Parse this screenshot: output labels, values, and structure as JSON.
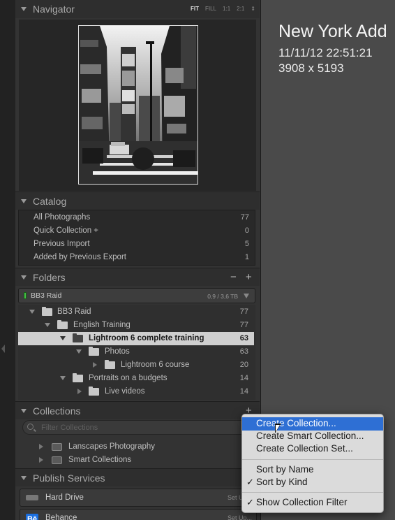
{
  "navigator": {
    "title": "Navigator",
    "zoom_options": [
      "FIT",
      "FILL",
      "1:1",
      "2:1"
    ],
    "active_zoom": "FIT"
  },
  "catalog": {
    "title": "Catalog",
    "items": [
      {
        "label": "All Photographs",
        "count": "77"
      },
      {
        "label": "Quick Collection  +",
        "count": "0"
      },
      {
        "label": "Previous Import",
        "count": "5"
      },
      {
        "label": "Added by Previous Export",
        "count": "1"
      }
    ]
  },
  "folders": {
    "title": "Folders",
    "minus": "−",
    "plus": "+",
    "volume": {
      "name": "BB3 Raid",
      "capacity": "0,9 / 3,6 TB",
      "status_color": "#43c043"
    },
    "items": [
      {
        "label": "BB3 Raid",
        "count": "77"
      },
      {
        "label": "English Training",
        "count": "77"
      },
      {
        "label": "Lightroom 6 complete training",
        "count": "63"
      },
      {
        "label": "Photos",
        "count": "63"
      },
      {
        "label": "Lightroom 6 course",
        "count": "20"
      },
      {
        "label": "Portraits on a budgets",
        "count": "14"
      },
      {
        "label": "Live videos",
        "count": "14"
      }
    ]
  },
  "collections": {
    "title": "Collections",
    "plus": "+",
    "filter_placeholder": "Filter Collections",
    "items": [
      {
        "label": "Lanscapes Photography"
      },
      {
        "label": "Smart Collections"
      }
    ]
  },
  "publish_services": {
    "title": "Publish Services",
    "items": [
      {
        "label": "Hard Drive",
        "action": "Set Up..."
      },
      {
        "label": "Behance",
        "action": "Set Up..."
      }
    ]
  },
  "photo_info": {
    "title": "New York Add",
    "date": "11/11/12 22:51:21",
    "dimensions": "3908 x 5193"
  },
  "context_menu": {
    "items": [
      {
        "label": "Create Collection...",
        "highlighted": true
      },
      {
        "label": "Create Smart Collection..."
      },
      {
        "label": "Create Collection Set..."
      },
      {
        "label": "Sort by Name"
      },
      {
        "label": "Sort by Kind",
        "checked": true
      },
      {
        "label": "Show Collection Filter",
        "checked": true
      }
    ],
    "checkmark": "✓",
    "highlight_color": "#2e6fd4"
  },
  "colors": {
    "panel_bg": "#333333",
    "main_bg": "#4a4a4a",
    "selected_row": "#cfcfcf"
  }
}
